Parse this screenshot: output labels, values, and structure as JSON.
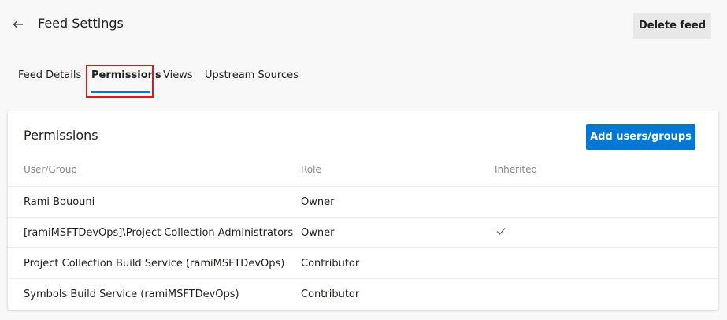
{
  "header": {
    "title": "Feed Settings",
    "delete_label": "Delete feed",
    "back_icon": "arrow-left-icon"
  },
  "tabs": [
    {
      "label": "Feed Details",
      "active": false
    },
    {
      "label": "Permissions",
      "active": true
    },
    {
      "label": "Views",
      "active": false
    },
    {
      "label": "Upstream Sources",
      "active": false
    }
  ],
  "permissions": {
    "title": "Permissions",
    "add_label": "Add users/groups",
    "columns": {
      "user": "User/Group",
      "role": "Role",
      "inherited": "Inherited"
    },
    "rows": [
      {
        "user": "Rami Bououni",
        "role": "Owner",
        "inherited": false
      },
      {
        "user": "[ramiMSFTDevOps]\\Project Collection Administrators",
        "role": "Owner",
        "inherited": true
      },
      {
        "user": "Project Collection Build Service (ramiMSFTDevOps)",
        "role": "Contributor",
        "inherited": false
      },
      {
        "user": "Symbols Build Service (ramiMSFTDevOps)",
        "role": "Contributor",
        "inherited": false
      }
    ]
  },
  "colors": {
    "accent": "#0078d4",
    "highlight": "#d71920",
    "muted": "#8a8886"
  }
}
